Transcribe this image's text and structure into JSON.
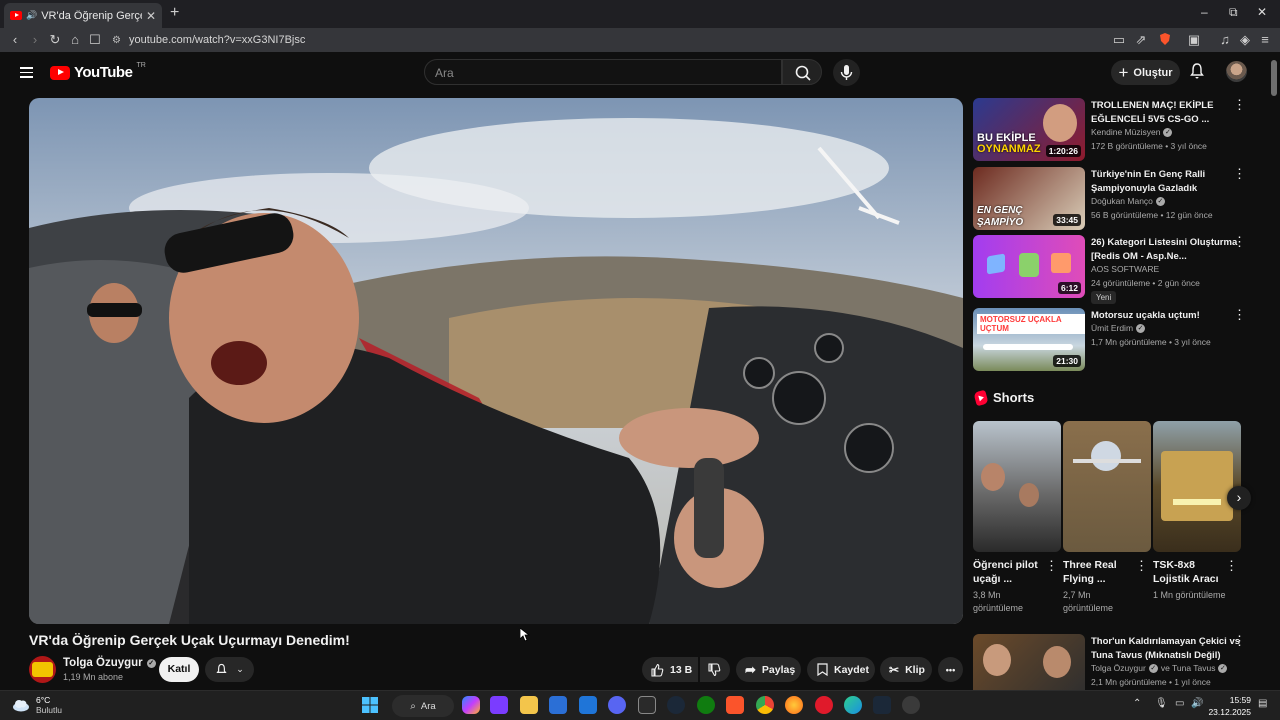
{
  "browser": {
    "tab_title": "VR'da Öğrenip Gerçek Uçak Uçurmayı Denedim!",
    "new_tab": "+",
    "url": "youtube.com/watch?v=xxG3NI7Bjsc",
    "window_controls": [
      "–",
      "⧉",
      "✕"
    ]
  },
  "masthead": {
    "logo_text": "YouTube",
    "country": "TR",
    "search_placeholder": "Ara",
    "create_label": "Oluştur"
  },
  "video": {
    "title": "VR'da Öğrenip Gerçek Uçak Uçurmayı Denedim!",
    "channel": "Tolga Özuygur",
    "subscribers": "1,19 Mn abone",
    "join_label": "Katıl",
    "likes": "13 B",
    "share_label": "Paylaş",
    "save_label": "Kaydet",
    "clip_label": "Klip",
    "more_label": "•••"
  },
  "recommendations": [
    {
      "title": "TROLLENEN MAÇ! EKİPLE EĞLENCELİ 5V5 CS-GO ...",
      "channel": "Kendine Müzisyen",
      "verified": true,
      "meta": "172 B görüntüleme • 3 yıl önce",
      "duration": "1:20:26",
      "thumb_text": "BU EKİPLE OYNANMAZ",
      "colors": [
        "#2b3a8f",
        "#d22"
      ]
    },
    {
      "title": "Türkiye'nin En Genç Ralli Şampiyonuyla Gazladık",
      "channel": "Doğukan Manço",
      "verified": true,
      "meta": "56 B görüntüleme • 12 gün önce",
      "duration": "33:45",
      "thumb_text": "EN GENÇ ŞAMPİYO",
      "colors": [
        "#7b2a1f",
        "#e8e0d0"
      ]
    },
    {
      "title": "26) Kategori Listesini Oluşturma [Redis OM - Asp.Ne...",
      "channel": "AOS SOFTWARE",
      "verified": false,
      "meta": "24 görüntüleme • 2 gün önce",
      "duration": "6:12",
      "badge": "Yeni",
      "thumb_text": "",
      "colors": [
        "#a23df0",
        "#e04cb8"
      ]
    },
    {
      "title": "Motorsuz uçakla uçtum!",
      "channel": "Ümit Erdim",
      "verified": true,
      "meta": "1,7 Mn görüntüleme • 3 yıl önce",
      "duration": "21:30",
      "thumb_text": "MOTORSUZ UÇAKLA UÇTUM",
      "colors": [
        "#6a8fb7",
        "#c9d6df"
      ]
    }
  ],
  "shorts": {
    "heading": "Shorts",
    "items": [
      {
        "title": "Öğrenci pilot uçağı ...",
        "views": "3,8 Mn görüntüleme"
      },
      {
        "title": "Three Real Flying ...",
        "views": "2,7 Mn görüntüleme"
      },
      {
        "title": "TSK-8x8 Lojistik Aracı",
        "views": "1 Mn görüntüleme"
      }
    ]
  },
  "next_rec": {
    "title": "Thor'un Kaldırılamayan Çekici vs Tuna Tavus (Mıknatıslı Değil)",
    "channel": "Tolga Özuygur",
    "collab": "ve Tuna Tavus",
    "meta": "2,1 Mn görüntüleme • 1 yıl önce"
  },
  "taskbar": {
    "temp": "6°C",
    "weather": "Bulutlu",
    "search_label": "Ara",
    "time": "15:59",
    "date": "23.12.2025"
  }
}
